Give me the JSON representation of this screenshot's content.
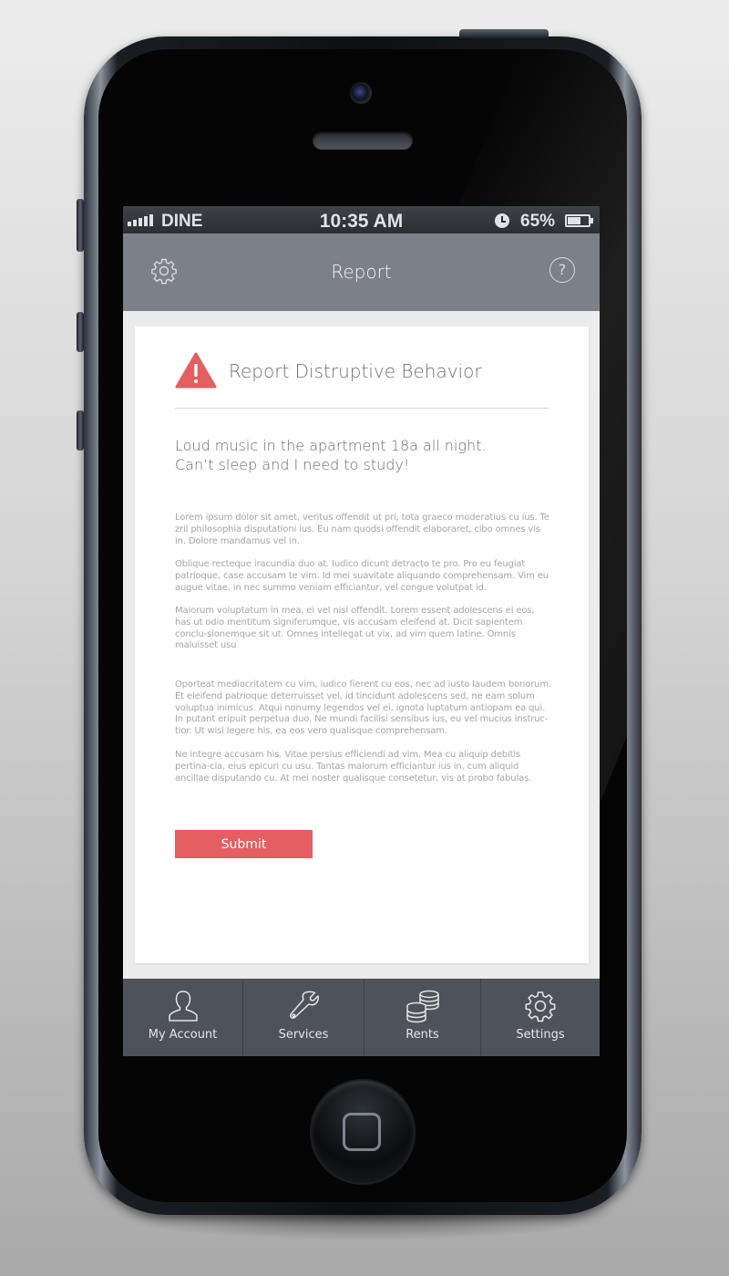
{
  "status_bar": {
    "carrier": "DINE",
    "time": "10:35 AM",
    "battery_percent": "65%",
    "battery_level": 0.65,
    "icons": [
      "signal-icon",
      "alarm-icon",
      "battery-icon"
    ]
  },
  "header": {
    "title": "Report",
    "left_icon": "gear-icon",
    "right_icon": "help-icon",
    "help_glyph": "?"
  },
  "card": {
    "icon": "warning-icon",
    "icon_glyph": "!",
    "title": "Report Distruptive Behavior",
    "message_lines": [
      "Loud music in the apartment 18a all night.",
      "Can’t sleep and I need to study!"
    ],
    "paragraphs": [
      "Lorem ipsum dolor sit amet, veritus offendit ut pri, tota graeco moderatius cu ius. Te zril philosophia disputationi ius. Eu nam quodsi offendit elaboraret, cibo omnes vis in. Dolore mandamus vel in.",
      "Oblique recteque iracundia duo at. Iudico dicunt detracto te pro. Pro eu feugiat patrioque, case accusam te vim. Id mei suavitate aliquando comprehensam. Vim eu augue vitae, in nec summo veniam efficiantur, vel congue volutpat id.",
      "Maiorum voluptatum in mea, ei vel nisl offendit. Lorem essent adolescens ei eos, has ut odio mentitum signiferumque, vis accusam eleifend at. Dicit sapientem conclu-sionemque sit ut. Omnes intellegat ut vix, ad vim quem latine. Omnis maluisset usu",
      "Oporteat mediocritatem cu vim, iudico fierent cu eos, nec ad iusto laudem bonorum. Et eleifend patrioque deterruisset vel, id tincidunt adolescens sed, ne eam solum voluptua inimicus. Atqui nonumy legendos vel ei, ignota luptatum antiopam ea qui. In putant eripuit perpetua duo. Ne mundi facilisi sensibus ius, eu vel mucius instruc-tior. Ut wisi legere his, ea eos vero qualisque comprehensam.",
      "Ne integre accusam his. Vitae persius efficiendi ad vim. Mea cu aliquip debitis pertina-cia, eius epicuri cu usu. Tantas malorum efficiantur ius in, cum aliquid ancillae disputando cu. At mei noster qualisque consetetur, vis at probo fabulas."
    ],
    "submit_label": "Submit"
  },
  "tab_bar": {
    "items": [
      {
        "label": "My Account",
        "icon": "user-icon"
      },
      {
        "label": "Services",
        "icon": "wrench-icon"
      },
      {
        "label": "Rents",
        "icon": "coins-icon"
      },
      {
        "label": "Settings",
        "icon": "gear-icon"
      }
    ]
  },
  "colors": {
    "accent": "#e35f62",
    "nav_bar": "#7b8089",
    "tab_bar": "#4e525a"
  }
}
